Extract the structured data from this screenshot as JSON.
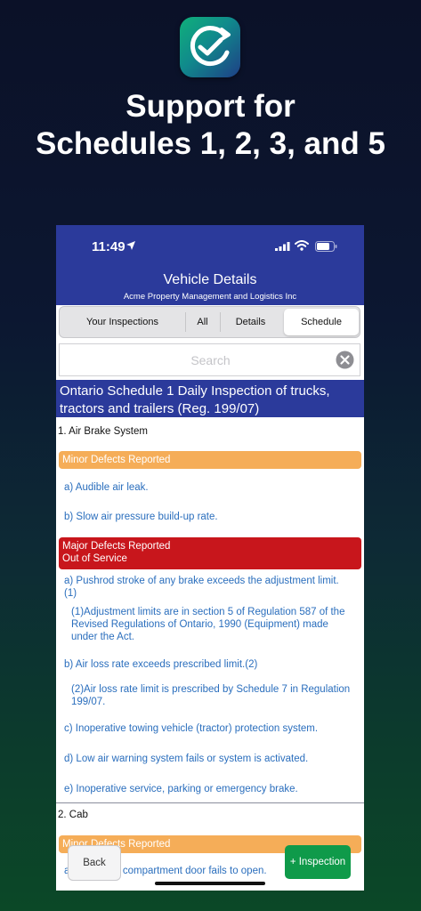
{
  "promo": {
    "headline_line1": "Support for",
    "headline_line2": "Schedules 1, 2, 3, and 5"
  },
  "status_bar": {
    "time": "11:49"
  },
  "nav": {
    "title": "Vehicle Details",
    "subtitle": "Acme Property Management and Logistics Inc"
  },
  "tabs": [
    {
      "label": "Your Inspections",
      "selected": false
    },
    {
      "label": "All",
      "selected": false
    },
    {
      "label": "Details",
      "selected": false
    },
    {
      "label": "Schedule",
      "selected": true
    }
  ],
  "search": {
    "placeholder": "Search"
  },
  "schedule": {
    "title": "Ontario Schedule 1 Daily Inspection of trucks, tractors and trailers (Reg. 199/07)",
    "sections": [
      {
        "heading": "1. Air Brake System",
        "minor_label": "Minor Defects Reported",
        "minor_items": [
          "a) Audible air leak.",
          "b) Slow air pressure build-up rate."
        ],
        "major_label_1": "Major Defects Reported",
        "major_label_2": "Out of Service",
        "major_items": [
          "a) Pushrod stroke of any brake exceeds the adjustment limit.(1)",
          "(1)Adjustment limits are in section 5 of Regulation 587 of the Revised Regulations of Ontario, 1990 (Equipment) made under the Act.",
          "b) Air loss rate exceeds prescribed limit.(2)",
          "(2)Air loss rate limit is prescribed by Schedule 7 in Regulation 199/07.",
          "c) Inoperative towing vehicle (tractor) protection system.",
          "d) Low air warning system fails or system is activated.",
          "e) Inoperative service, parking or emergency brake."
        ]
      },
      {
        "heading": "2. Cab",
        "minor_label": "Minor Defects Reported",
        "minor_items": [
          "a) Occupant compartment door fails to open."
        ]
      }
    ]
  },
  "buttons": {
    "back": "Back",
    "add_inspection": "+ Inspection"
  },
  "colors": {
    "nav_bar": "#2b3a9b",
    "minor_defects": "#f5ad58",
    "major_defects": "#c8161c",
    "item_text": "#2a6ebd",
    "add_button": "#0f9a4a"
  },
  "icons": [
    "app-icon",
    "location-arrow-icon",
    "signal-icon",
    "wifi-icon",
    "battery-icon",
    "clear-search-icon"
  ]
}
